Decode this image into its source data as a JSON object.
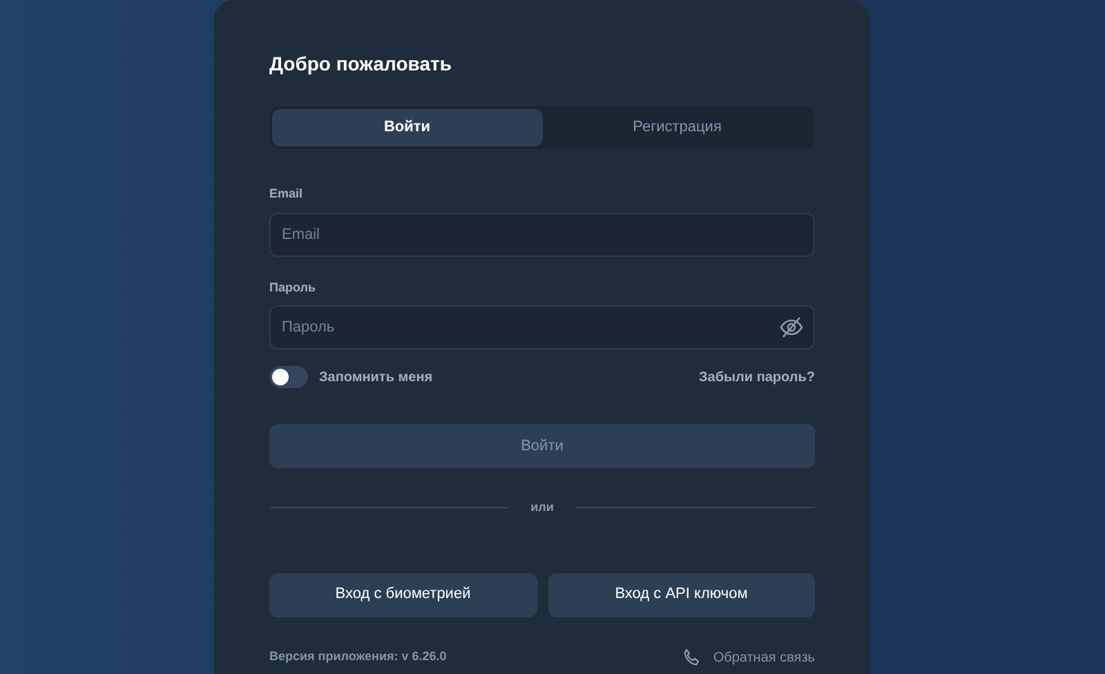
{
  "title": "Добро пожаловать",
  "tabs": [
    {
      "label": "Войти",
      "selected": true
    },
    {
      "label": "Регистрация",
      "selected": false
    }
  ],
  "fields": [
    {
      "label": "Email",
      "placeholder": "Email",
      "kind": "text"
    },
    {
      "label": "Пароль",
      "placeholder": "Пароль",
      "kind": "password"
    }
  ],
  "remember": {
    "label": "Запомнить меня",
    "on": false
  },
  "forgot_link": "Забыли пароль?",
  "submit": {
    "label": "Войти",
    "disabled": true
  },
  "divider_text": "или",
  "alt_buttons": [
    "Вход с биометрией",
    "Вход с API ключом"
  ],
  "footer": {
    "version": "Версия приложения: v 6.26.0",
    "feedback": "Обратная связь"
  }
}
